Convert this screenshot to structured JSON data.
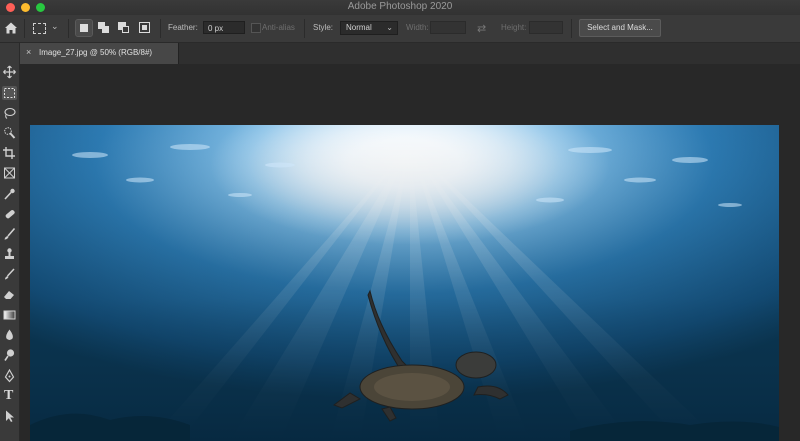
{
  "window": {
    "title": "Adobe Photoshop 2020"
  },
  "options_bar": {
    "feather_label": "Feather:",
    "feather_value": "0 px",
    "anti_alias_label": "Anti-alias",
    "style_label": "Style:",
    "style_value": "Normal",
    "width_label": "Width:",
    "height_label": "Height:",
    "select_mask_label": "Select and Mask..."
  },
  "document": {
    "tab_title": "Image_27.jpg @ 50% (RGB/8#)",
    "close_glyph": "×"
  },
  "toolbar": {
    "tools": [
      "move-tool",
      "rectangular-marquee-tool",
      "lasso-tool",
      "quick-selection-tool",
      "crop-tool",
      "frame-tool",
      "eyedropper-tool",
      "healing-brush-tool",
      "brush-tool",
      "clone-stamp-tool",
      "history-brush-tool",
      "eraser-tool",
      "gradient-tool",
      "blur-tool",
      "dodge-tool",
      "pen-tool",
      "type-tool",
      "path-selection-tool"
    ],
    "selected": "rectangular-marquee-tool",
    "type_glyph": "T"
  },
  "colors": {
    "accent": "#4a4a4a",
    "ocean_deep": "#0b3550",
    "ocean_light": "#4d9fd0"
  }
}
